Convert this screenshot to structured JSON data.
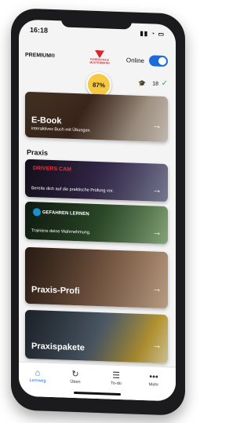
{
  "status": {
    "time": "16:18"
  },
  "header": {
    "plan": "PREMIUM®",
    "school_logo": "FAHRSCHULE MUSTERMANN",
    "online_label": "Online",
    "progress_text": "87%",
    "count": "18"
  },
  "cards": [
    {
      "title": "E-Book",
      "subtitle": "interaktives Buch mit Übungen"
    },
    {
      "logo": "DRIVERS CAM",
      "subtitle": "Bereite dich auf die praktische Prüfung vor."
    },
    {
      "logo": "GEFAHREN LERNEN",
      "subtitle": "Trainiere deine Wahrnehmung."
    },
    {
      "title": "Praxis-Profi"
    },
    {
      "title": "Praxispakete"
    }
  ],
  "section": {
    "title": "Praxis"
  },
  "tabs": [
    {
      "label": "Lernweg",
      "icon": "home-icon"
    },
    {
      "label": "Üben",
      "icon": "refresh-icon"
    },
    {
      "label": "To-do",
      "icon": "list-icon"
    },
    {
      "label": "Mehr",
      "icon": "more-icon"
    }
  ],
  "colors": {
    "accent": "#1c6bdc",
    "progress": "#f6c945",
    "check": "#2ea44f"
  }
}
